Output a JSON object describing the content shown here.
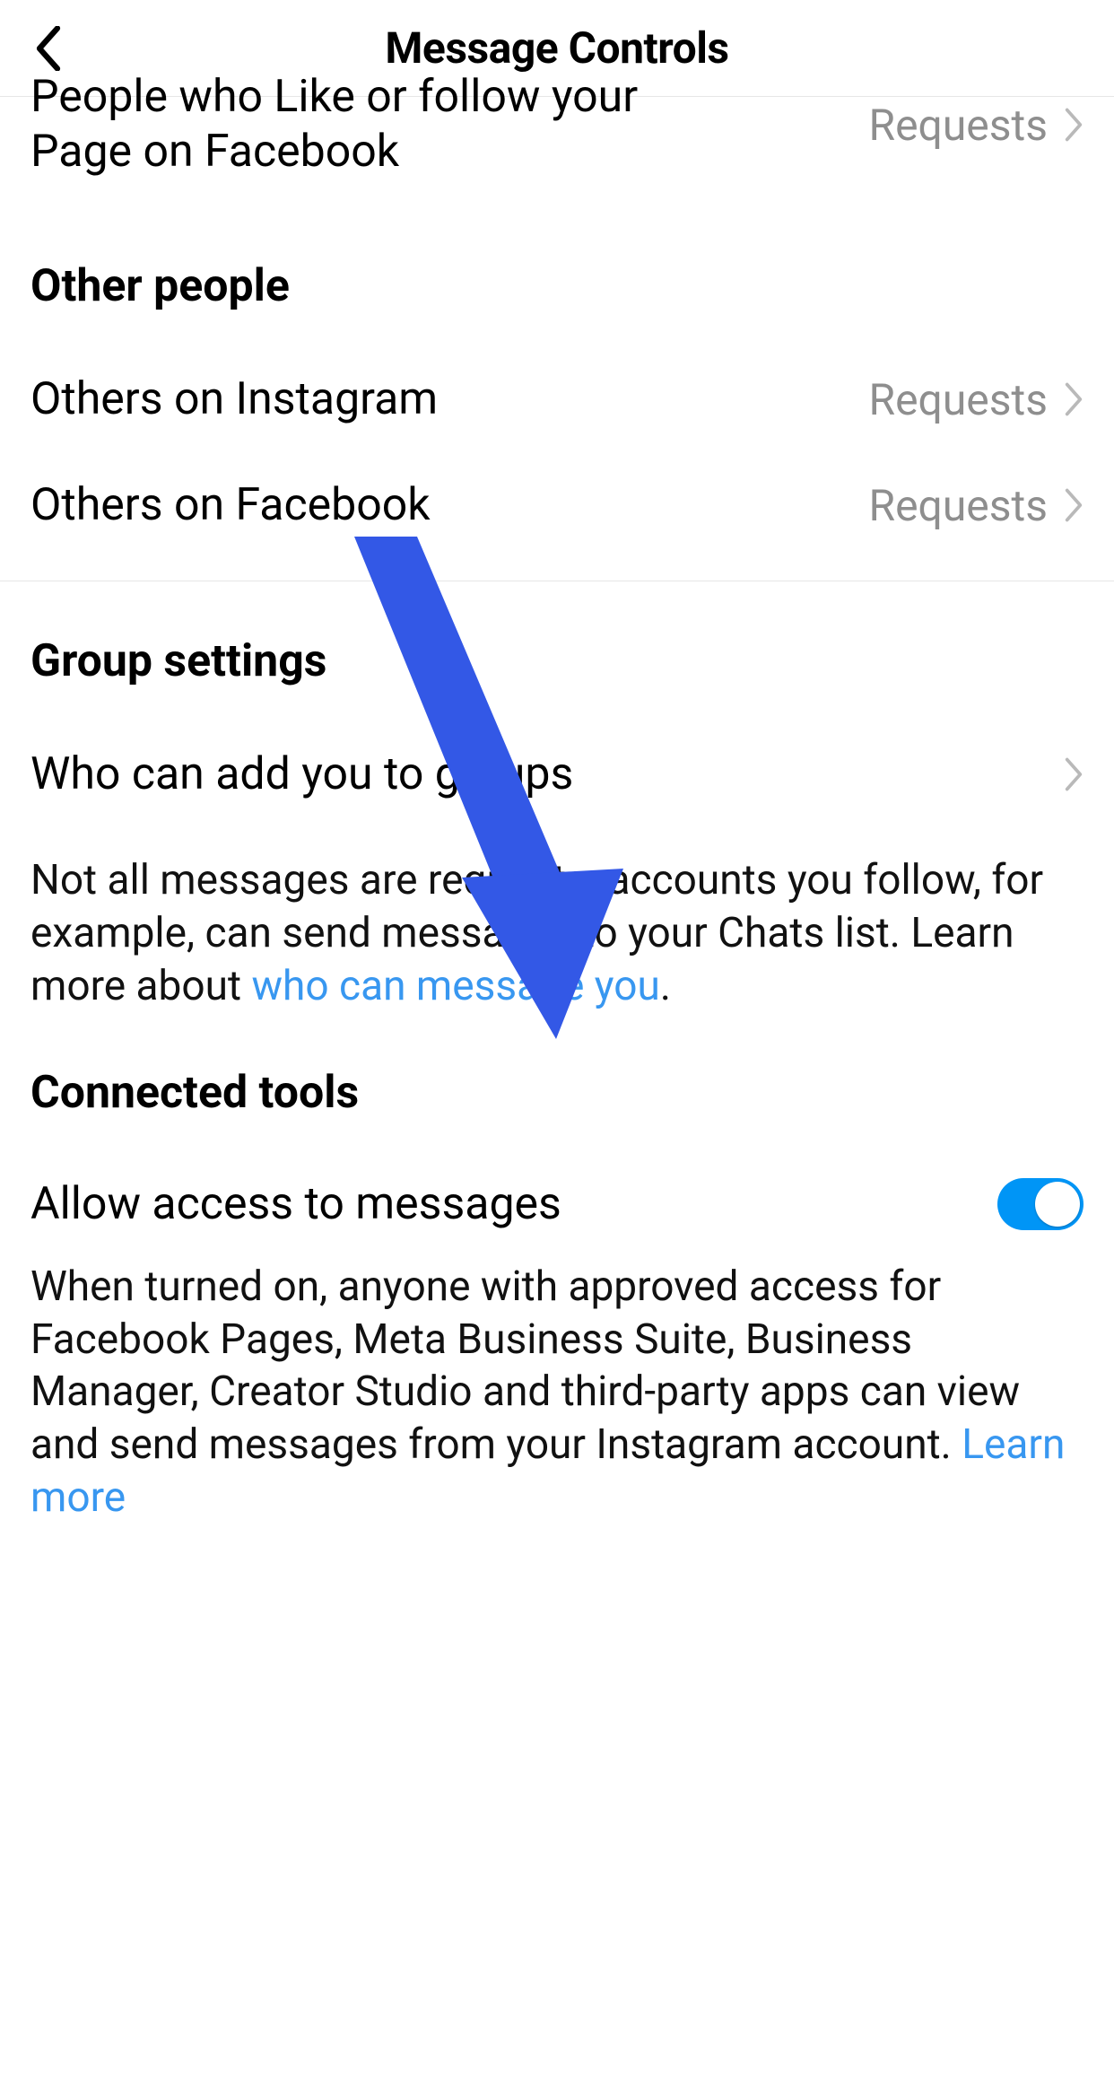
{
  "header": {
    "title": "Message Controls"
  },
  "cutoff_row": {
    "label": "People who Like or follow your Page on Facebook",
    "value": "Requests"
  },
  "section_other": {
    "title": "Other people",
    "rows": [
      {
        "label": "Others on Instagram",
        "value": "Requests"
      },
      {
        "label": "Others on Facebook",
        "value": "Requests"
      }
    ]
  },
  "section_group": {
    "title": "Group settings",
    "row": {
      "label": "Who can add you to groups"
    },
    "info_pre": "Not all messages are requests: accounts you follow, for example, can send messages to your Chats list. Learn more about ",
    "info_link": "who can message you",
    "info_post": "."
  },
  "section_connected": {
    "title": "Connected tools",
    "toggle_label": "Allow access to messages",
    "desc_pre": "When turned on, anyone with approved access for Facebook Pages, Meta Business Suite, Business Manager, Creator Studio and third-party apps can view and send messages from your Instagram account. ",
    "desc_link": "Learn more"
  }
}
